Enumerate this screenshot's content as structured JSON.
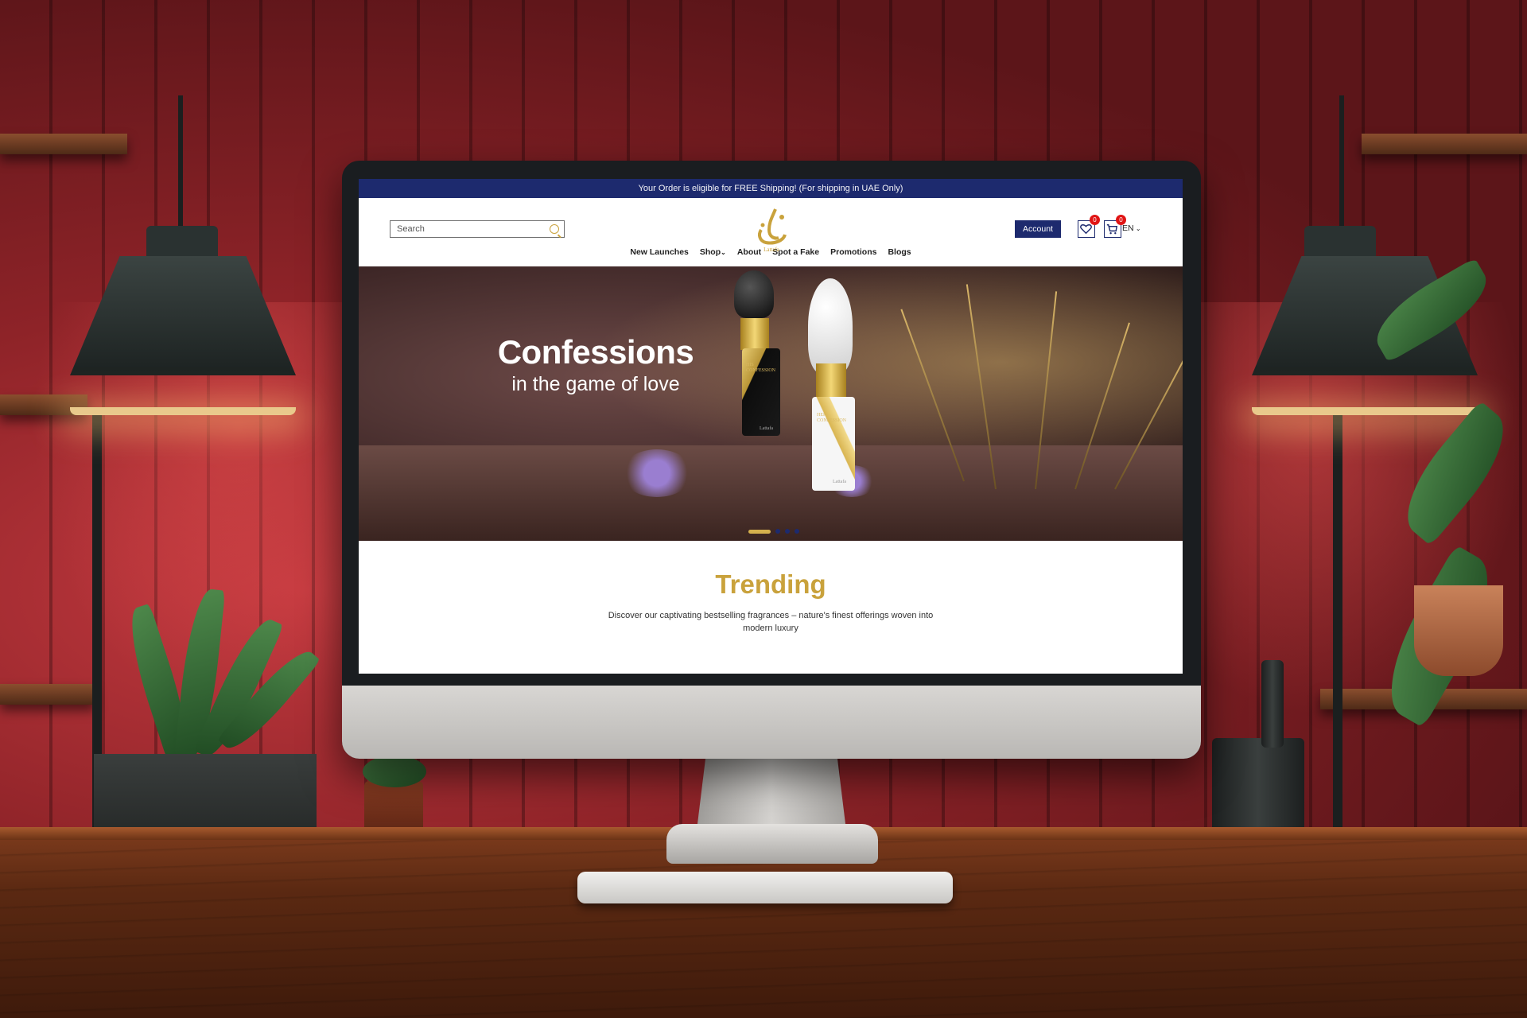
{
  "colors": {
    "brand_navy": "#1d2a6e",
    "brand_gold": "#c9a23c",
    "badge_red": "#e01414"
  },
  "promo_bar": {
    "text": "Your Order is eligible for FREE Shipping! (For shipping in UAE Only)"
  },
  "header": {
    "search_placeholder": "Search",
    "search_icon": "search-icon",
    "logo_text": "Lattafa",
    "account_label": "Account",
    "wishlist_icon": "heart-icon",
    "wishlist_count": "0",
    "cart_icon": "cart-icon",
    "cart_count": "0",
    "language": "EN"
  },
  "nav": {
    "items": [
      "New Launches",
      "Shop",
      "About",
      "Spot a Fake",
      "Promotions",
      "Blogs"
    ]
  },
  "hero": {
    "title": "Confessions",
    "subtitle": "in the game of love",
    "bottle_left_label_small": "HIS",
    "bottle_left_label": "CONFESSION",
    "bottle_left_brand": "Lattafa",
    "bottle_right_label_small": "HER",
    "bottle_right_label": "CONFESSION",
    "bottle_right_brand": "Lattafa",
    "slide_count": 4,
    "active_slide": 1
  },
  "trending": {
    "title": "Trending",
    "description": "Discover our captivating bestselling fragrances – nature's finest offerings woven into modern luxury"
  }
}
